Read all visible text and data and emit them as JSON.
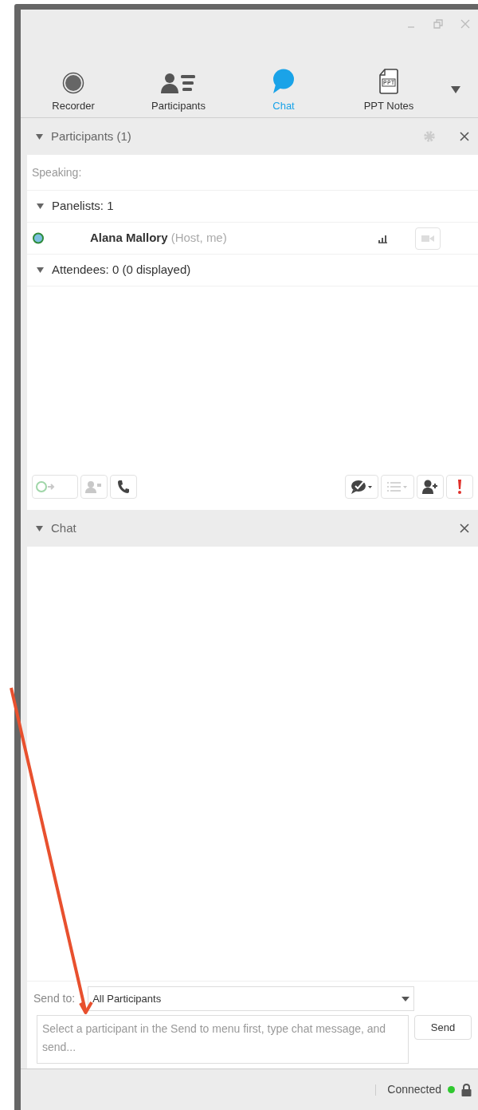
{
  "tabs": [
    {
      "label": "Recorder",
      "kind": "recorder",
      "selected": false
    },
    {
      "label": "Participants",
      "kind": "participants",
      "selected": false
    },
    {
      "label": "Chat",
      "kind": "chat",
      "selected": true
    },
    {
      "label": "PPT Notes",
      "kind": "ppt",
      "selected": false
    }
  ],
  "participants_panel": {
    "title": "Participants (1)",
    "speaking": "Speaking:",
    "groups": [
      {
        "label": "Panelists: 1",
        "expanded": true,
        "members": [
          {
            "name": "Alana Mallory",
            "role": "(Host, me)"
          }
        ]
      },
      {
        "label": "Attendees: 0 (0 displayed)",
        "expanded": true
      }
    ],
    "toolbar_left": [
      {
        "kind": "pass-ball",
        "disabled": true
      },
      {
        "kind": "video-person",
        "disabled": true
      },
      {
        "kind": "phone",
        "disabled": false
      }
    ],
    "toolbar_right": [
      {
        "kind": "feedback",
        "disabled": false
      },
      {
        "kind": "list",
        "disabled": true
      },
      {
        "kind": "add-person",
        "disabled": false
      },
      {
        "kind": "alert",
        "disabled": false
      }
    ]
  },
  "chat_panel": {
    "title": "Chat",
    "send_to_label": "Send to:",
    "send_to_value": "All Participants",
    "placeholder": "Select a participant in the Send to menu first, type chat message, and send...",
    "send_button": "Send"
  },
  "status_bar": {
    "status": "Connected",
    "connected": true
  }
}
